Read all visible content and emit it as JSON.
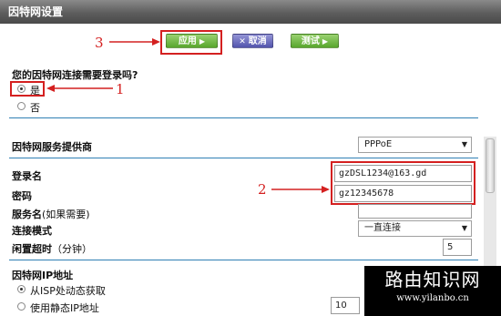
{
  "title": "因特网设置",
  "toolbar": {
    "apply_label": "应用",
    "cancel_label": "取消",
    "test_label": "测试"
  },
  "annotations": {
    "n1": "1",
    "n2": "2",
    "n3": "3"
  },
  "login_question": {
    "label": "您的因特网连接需要登录吗?",
    "option_yes": "是",
    "option_no": "否",
    "selected": "是"
  },
  "isp": {
    "label": "因特网服务提供商",
    "value": "PPPoE"
  },
  "login": {
    "label": "登录名",
    "value": "gzDSL1234@163.gd"
  },
  "password": {
    "label": "密码",
    "value": "gz12345678"
  },
  "service_name": {
    "label": "服务名",
    "hint": "(如果需要)",
    "value": ""
  },
  "connection_mode": {
    "label": "连接模式",
    "value": "一直连接"
  },
  "idle_timeout": {
    "label": "闲置超时",
    "unit": "（分钟）",
    "value": "5"
  },
  "ip_address": {
    "label": "因特网IP地址",
    "option_dynamic": "从ISP处动态获取",
    "option_static": "使用静态IP地址",
    "ip_first_octet": "10",
    "selected": "从ISP处动态获取"
  },
  "watermark": {
    "line1": "路由知识网",
    "line2": "www.yilanbo.cn"
  },
  "colors": {
    "title_bar": "#5d5d5d",
    "apply_green": "#58a62d",
    "cancel_purple": "#5354ad",
    "separator_blue": "#2f7fb4",
    "annotation_red": "#d42020"
  }
}
